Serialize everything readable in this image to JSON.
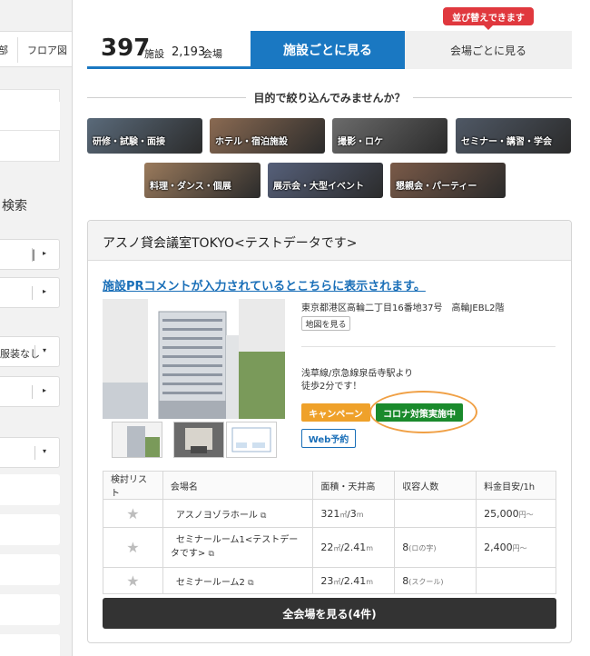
{
  "sidebar": {
    "tab_prev": "部",
    "tab_floor": "フロア図",
    "search_title": "検索",
    "dress_code": "服装なし"
  },
  "header": {
    "facility_count": "397",
    "facility_unit": "施設",
    "venue_count": "2,193",
    "venue_unit": "会場",
    "tab_facility": "施設ごとに見る",
    "tab_venue": "会場ごとに見る",
    "sort_badge": "並び替えできます"
  },
  "purpose": {
    "heading": "目的で絞り込んでみませんか？",
    "tiles": [
      {
        "label": "研修・試験・面接",
        "color": "#5a6a7a"
      },
      {
        "label": "ホテル・宿泊施設",
        "color": "#8a6a52"
      },
      {
        "label": "撮影・ロケ",
        "color": "#6b6b6b"
      },
      {
        "label": "セミナー・講習・学会",
        "color": "#4f5865"
      },
      {
        "label": "料理・ダンス・個展",
        "color": "#9a7a5c"
      },
      {
        "label": "展示会・大型イベント",
        "color": "#56607a"
      },
      {
        "label": "懇親会・パーティー",
        "color": "#7a5a48"
      }
    ]
  },
  "facility": {
    "name": "アスノ貸会議室TOKYO<テストデータです>",
    "pr_comment": "施設PRコメントが入力されているとこちらに表示されます。",
    "address": "東京都港区高輪二丁目16番地37号　高輪JEBL2階",
    "map_button": "地図を見る",
    "access_line1": "浅草線/京急線泉岳寺駅より",
    "access_line2": "徒歩2分です！",
    "campaign_label": "キャンペーン",
    "corona_label": "コロナ対策実施中",
    "web_booking_label": "Web予約",
    "view_all_label": "全会場を見る(4件)"
  },
  "table": {
    "headers": [
      "検討リスト",
      "会場名",
      "面積・天井高",
      "収容人数",
      "料金目安/1h"
    ],
    "rows": [
      {
        "name": "アスノヨゾラホール",
        "area": "321",
        "area_unit": "㎡",
        "height": "3",
        "height_unit": "m",
        "capacity": "",
        "capacity_note": "",
        "price": "25,000",
        "price_unit": "円～"
      },
      {
        "name": "セミナールーム1<テストデータです>",
        "area": "22",
        "area_unit": "㎡",
        "height": "2.41",
        "height_unit": "m",
        "capacity": "8",
        "capacity_note": "(ロの字)",
        "price": "2,400",
        "price_unit": "円～"
      },
      {
        "name": "セミナールーム2",
        "area": "23",
        "area_unit": "㎡",
        "height": "2.41",
        "height_unit": "m",
        "capacity": "8",
        "capacity_note": "(スクール)",
        "price": "",
        "price_unit": ""
      }
    ]
  },
  "symbols": {
    "star": "★",
    "external": "⧉",
    "slash": "/",
    "caret": "▸",
    "caret_down": "▾",
    "bar": "|"
  },
  "colors": {
    "accent_blue": "#1a78c2",
    "badge_red": "#e0383e",
    "campaign_orange": "#efa12a",
    "corona_green": "#1a8a2c",
    "highlight_ring": "#f0a045"
  }
}
